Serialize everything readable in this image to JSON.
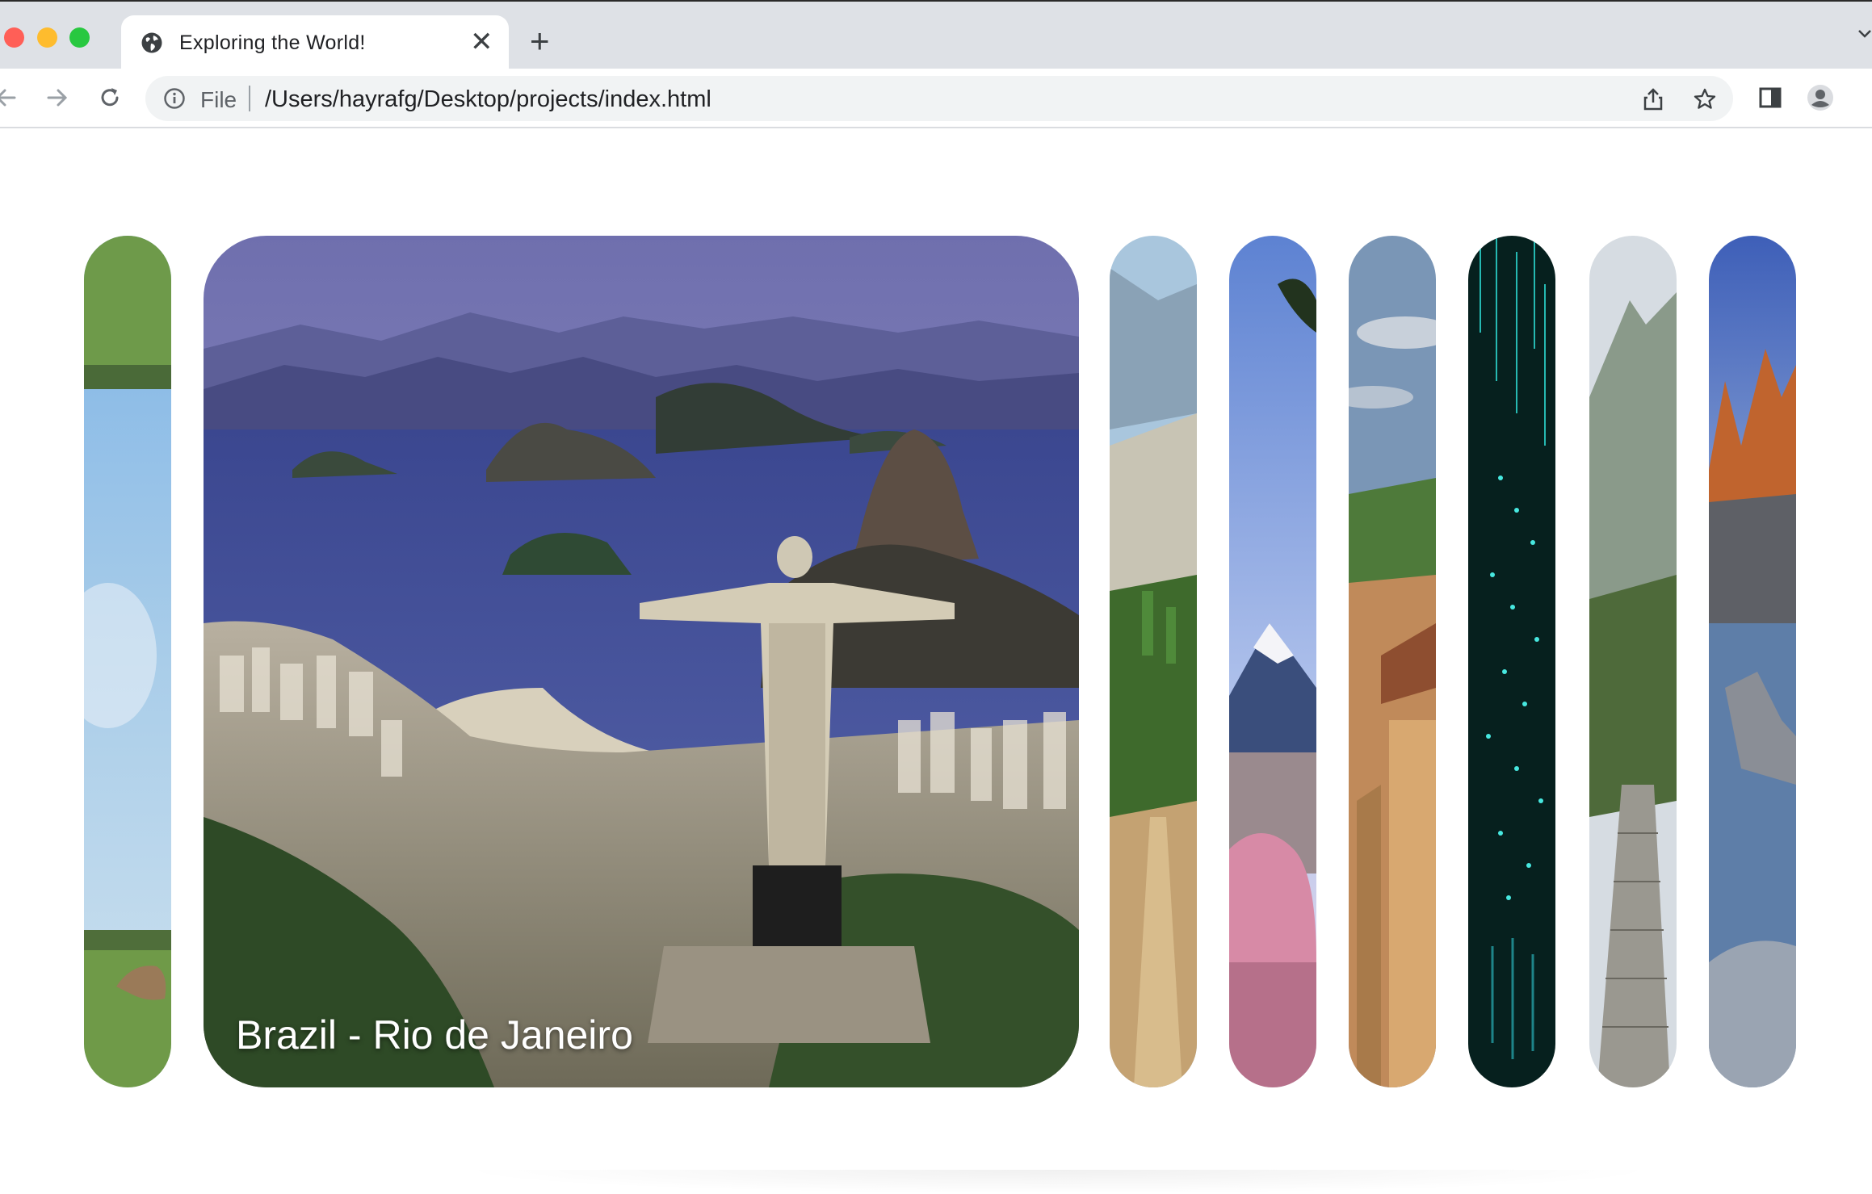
{
  "browser": {
    "tab_title": "Exploring the World!",
    "tab_close": "✕",
    "new_tab": "+",
    "scheme": "File",
    "url": "/Users/hayrafg/Desktop/projects/index.html"
  },
  "gallery": {
    "active_caption": "Brazil - Rio de Janeiro"
  },
  "colors": {
    "accent_blue": "#3b4fa0",
    "caption_text": "#ffffff"
  }
}
